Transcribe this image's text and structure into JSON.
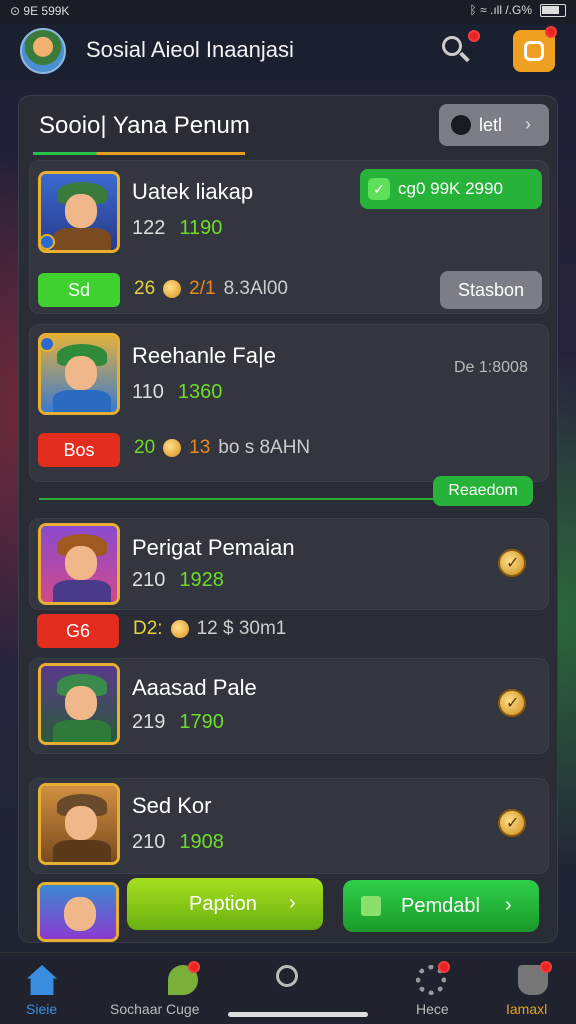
{
  "status": {
    "left": "⊙ 9E 599K",
    "right": "ᛒ ≈ .ıll /.G%"
  },
  "app": {
    "title": "Sosial Aieol Inaanjasi"
  },
  "panel": {
    "title": "Sooio| Yana Penum",
    "header_button": "letl"
  },
  "players": [
    {
      "name": "Uatek liakap",
      "stat1": "122",
      "stat2": "1190",
      "status_chip": "cg0  99K 2990",
      "tag": "Sd",
      "tag_color": "#3fd12e",
      "line_a": "26",
      "line_b": "2/1",
      "line_c": "8.3Al00",
      "action": "Stasbon"
    },
    {
      "name": "Reehanle Fa|e",
      "stat1": "110",
      "stat2": "1360",
      "date_text": "De 1:8008",
      "tag": "Bos",
      "tag_color": "#e22d1f",
      "line_a": "20",
      "line_b": "13",
      "line_c": "bo s 8AHN",
      "highlight": "Reaedom"
    },
    {
      "name": "Perigat Pemaian",
      "stat1": "210",
      "stat2": "1928",
      "tag": "G6",
      "tag_color": "#e22d1f",
      "line_a": "D2:",
      "line_c": "12 $ 30m1"
    },
    {
      "name": "Aaasad Pale",
      "stat1": "219",
      "stat2": "1790"
    },
    {
      "name": "Sed Kor",
      "stat1": "210",
      "stat2": "1908"
    }
  ],
  "buttons": {
    "left": "Paption",
    "right": "Pemdabl"
  },
  "nav": [
    {
      "label": "Sieie",
      "icon": "home-icon",
      "color": "#3a8ee0"
    },
    {
      "label": "Sochaar Cuge",
      "icon": "plant-icon",
      "color": "#bbbbbb"
    },
    {
      "label": "",
      "icon": "search-icon",
      "color": "#bbbbbb"
    },
    {
      "label": "Hece",
      "icon": "gear-icon",
      "color": "#bbbbbb"
    },
    {
      "label": "Iamaxl",
      "icon": "trophy-icon",
      "color": "#e8a020"
    }
  ]
}
